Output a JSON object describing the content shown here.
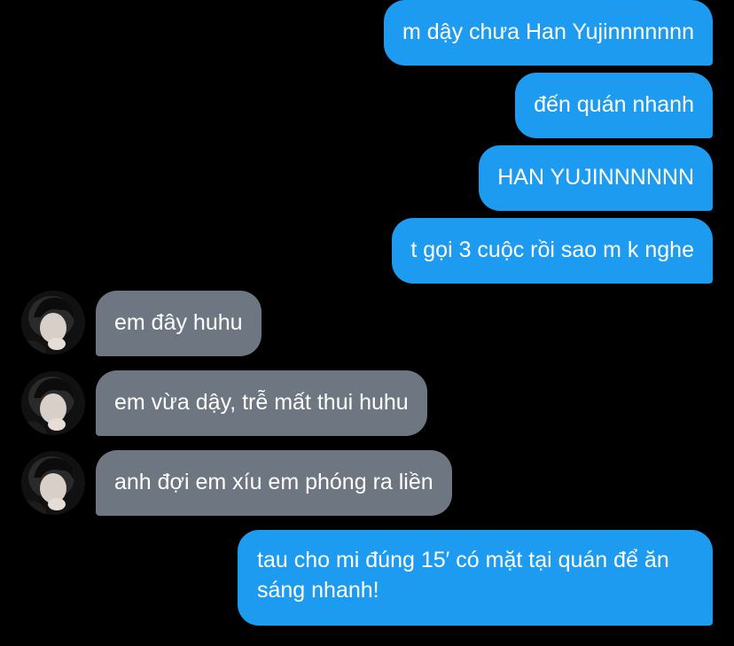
{
  "conversation": {
    "messages": [
      {
        "sender": "me",
        "text": "m dậy chưa Han Yujinnnnnnn"
      },
      {
        "sender": "me",
        "text": "đến quán nhanh"
      },
      {
        "sender": "me",
        "text": "HAN YUJINNNNNN"
      },
      {
        "sender": "me",
        "text": "t gọi 3 cuộc rồi sao m k nghe"
      },
      {
        "sender": "other",
        "text": "em đây huhu"
      },
      {
        "sender": "other",
        "text": "em vừa dậy, trễ mất thui huhu"
      },
      {
        "sender": "other",
        "text": "anh đợi em xíu em phóng ra liền"
      },
      {
        "sender": "me",
        "text": "tau cho mi đúng 15′ có mặt tại quán để ăn sáng nhanh!"
      }
    ]
  },
  "colors": {
    "background": "#000000",
    "outgoing_bubble": "#1d9bf0",
    "incoming_bubble": "#6e7781",
    "text": "#ffffff"
  },
  "icons": {
    "contact_avatar": "avatar-photo"
  }
}
